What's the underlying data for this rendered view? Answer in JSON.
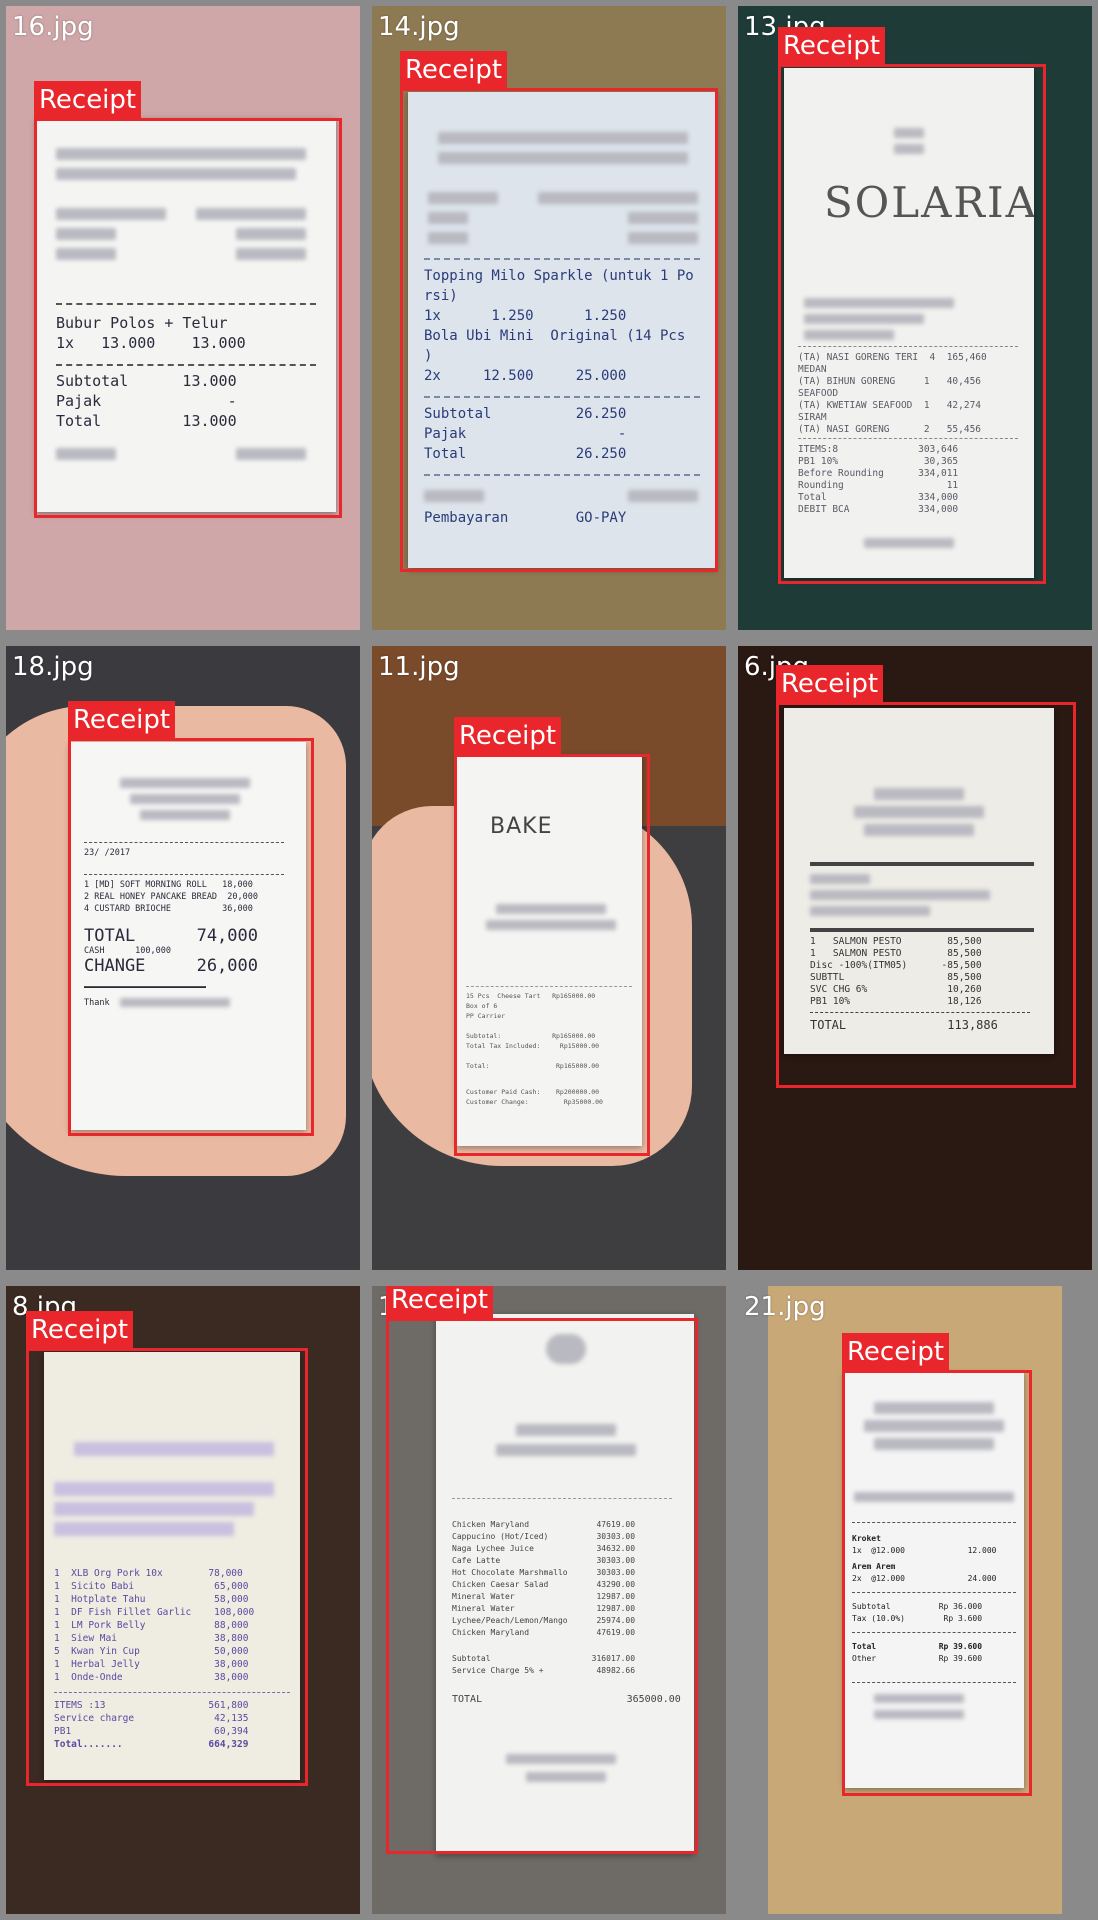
{
  "box_label": "Receipt",
  "tiles": [
    {
      "file": "16.jpg",
      "lines": [
        "Bubur Polos + Telur",
        "1x   13.000    13.000",
        "Subtotal      13.000",
        "Pajak              -",
        "Total         13.000"
      ]
    },
    {
      "file": "14.jpg",
      "lines": [
        "Topping Milo Sparkle (untuk 1 Po",
        "rsi)",
        "1x      1.250      1.250",
        "Bola Ubi Mini  Original (14 Pcs",
        ")",
        "2x     12.500     25.000",
        "Subtotal          26.250",
        "Pajak                  -",
        "Total             26.250",
        "Pembayaran        GO-PAY"
      ]
    },
    {
      "file": "13.jpg",
      "lines": [
        "SOLARIA",
        "(TA) NASI GORENG TERI  4  165,460",
        "MEDAN",
        "(TA) BIHUN GORENG     1   40,456",
        "SEAFOOD",
        "(TA) KWETIAW SEAFOOD  1   42,274",
        "SIRAM",
        "(TA) NASI GORENG      2   55,456",
        "ITEMS:8              303,646",
        "PB1 10%               30,365",
        "Before Rounding      334,011",
        "Rounding                  11",
        "Total                334,000",
        "DEBIT BCA            334,000"
      ]
    },
    {
      "file": "18.jpg",
      "lines": [
        "23/ /2017",
        "1 [MD] SOFT MORNING ROLL   18,000",
        "2 REAL HONEY PANCAKE BREAD  20,000",
        "4 CUSTARD BRIOCHE          36,000",
        "TOTAL      74,000",
        "CASH      100,000",
        "CHANGE     26,000",
        "Thank"
      ]
    },
    {
      "file": "11.jpg",
      "lines": [
        "BAKE",
        "15 Pcs  Cheese Tart   Rp165000.00",
        "Box of 6",
        "PP Carrier",
        "Subtotal:             Rp165000.00",
        "Total Tax Included:     Rp15000.00",
        "Total:                 Rp165000.00",
        "Customer Paid Cash:    Rp200000.00",
        "Customer Change:         Rp35000.00"
      ]
    },
    {
      "file": "6.jpg",
      "lines": [
        "1   SALMON PESTO        85,500",
        "1   SALMON PESTO        85,500",
        "Disc -100%(ITM05)      -85,500",
        "SUBTTL                  85,500",
        "SVC CHG 6%              10,260",
        "PB1 10%                 18,126",
        "TOTAL              113,886"
      ]
    },
    {
      "file": "8.jpg",
      "lines": [
        "1  XLB Org Pork 10x        78,000",
        "1  Sicito Babi              65,000",
        "1  Hotplate Tahu            58,000",
        "1  DF Fish Fillet Garlic    108,000",
        "1  LM Pork Belly            88,000",
        "1  Siew Mai                 38,800",
        "5  Kwan Yin Cup             50,000",
        "1  Herbal Jelly             38,000",
        "1  Onde-Onde                38,000",
        "ITEMS :13                  561,800",
        "Service charge              42,135",
        "PB1                         60,394",
        "Total.......               664,329"
      ]
    },
    {
      "file": "1",
      "lines": [
        "Chicken Maryland              47619.00",
        "Cappucino (Hot/Iced)          30303.00",
        "Naga Lychee Juice             34632.00",
        "Cafe Latte                    30303.00",
        "Hot Chocolate Marshmallo      30303.00",
        "Chicken Caesar Salad          43290.00",
        "Mineral Water                 12987.00",
        "Mineral Water                 12987.00",
        "Lychee/Peach/Lemon/Mango      25974.00",
        "Chicken Maryland              47619.00",
        "Subtotal                     316017.00",
        "Service Charge 5% +           48982.66",
        "TOTAL                        365000.00"
      ]
    },
    {
      "file": "21.jpg",
      "lines": [
        "Kroket",
        "1x  @12.000             12.000",
        "Arem Arem",
        "2x  @12.000             24.000",
        "Subtotal          Rp 36.000",
        "Tax (10.0%)        Rp 3.600",
        "Total             Rp 39.600",
        "Other             Rp 39.600"
      ]
    }
  ]
}
